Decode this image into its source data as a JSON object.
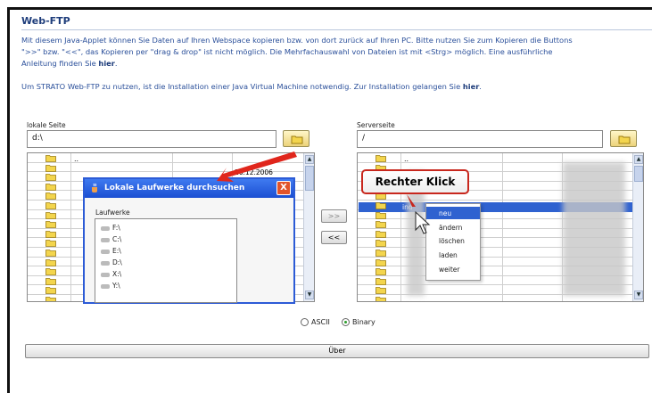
{
  "page": {
    "title": "Web-FTP",
    "intro_line1": "Mit diesem Java-Applet können Sie Daten auf Ihren Webspace kopieren bzw. von dort zurück auf Ihren PC. Bitte nutzen Sie zum Kopieren die Buttons",
    "intro_line2": "\">>\" bzw. \"<<\", das Kopieren per \"drag & drop\" ist nicht möglich. Die Mehrfachauswahl von Dateien ist mit <Strg> möglich. Eine ausführliche",
    "intro_line3_prefix": "Anleitung finden Sie",
    "intro_link": "hier",
    "intro_suffix": ".",
    "java_text": "Um STRATO Web-FTP zu nutzen, ist die Installation einer Java Virtual Machine notwendig. Zur Installation gelangen Sie",
    "java_link": "hier",
    "java_suffix": "."
  },
  "local": {
    "label": "lokale Seite",
    "path": "d:\\",
    "parent_entry": "..",
    "date_fragment": "26.12.2006"
  },
  "remote": {
    "label": "Serverseite",
    "path": "/",
    "parent_entry": "..",
    "selected_fragment": "ind"
  },
  "transfer": {
    "upload_label": ">>",
    "download_label": "<<"
  },
  "dialog": {
    "title": "Lokale Laufwerke durchsuchen",
    "close_label": "X",
    "list_label": "Laufwerke",
    "drives": [
      "F:\\",
      "C:\\",
      "E:\\",
      "D:\\",
      "X:\\",
      "Y:\\"
    ]
  },
  "context_menu": {
    "items": [
      "neu",
      "ändern",
      "löschen",
      "laden",
      "weiter"
    ]
  },
  "callout": {
    "text": "Rechter Klick",
    "color": "#c8271d"
  },
  "mode": {
    "ascii_label": "ASCII",
    "binary_label": "Binary",
    "selected": "Binary"
  },
  "footer": {
    "ueber_label": "Über"
  },
  "colors": {
    "accent": "#2f62d0",
    "title": "#1e3d7b",
    "text": "#2a4f9a",
    "arrow": "#e0261c"
  }
}
